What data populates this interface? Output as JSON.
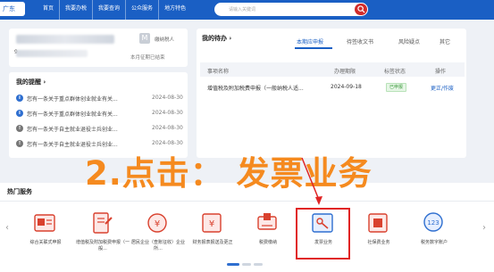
{
  "header": {
    "region": "广东",
    "nav": [
      "首页",
      "我要办税",
      "我要查询",
      "公众服务",
      "地方特色"
    ],
    "search_placeholder": "请输入关键词"
  },
  "user": {
    "id_prefix": "9",
    "role": "缴纳税人",
    "period": "本月征期已结束",
    "badge": "M"
  },
  "reminders": {
    "title": "我的提醒 ›",
    "items": [
      {
        "text": "您有一条关于重点群体创业就业有关...",
        "date": "2024-08-30",
        "color": "#2f6fd0",
        "icon": "i"
      },
      {
        "text": "您有一条关于重点群体创业就业有关...",
        "date": "2024-08-30",
        "color": "#2f6fd0",
        "icon": "i"
      },
      {
        "text": "您有一条关于自主就业退役士兵创业...",
        "date": "2024-08-30",
        "color": "#777777",
        "icon": "!"
      },
      {
        "text": "您有一条关于自主就业退役士兵创业...",
        "date": "2024-08-30",
        "color": "#777777",
        "icon": "!"
      }
    ]
  },
  "todo": {
    "title": "我的待办 ›",
    "tabs": [
      "本期应申报",
      "待签收文书",
      "风险疑点",
      "其它"
    ],
    "columns": [
      "事项名称",
      "办理期限",
      "标签状态",
      "操作"
    ],
    "rows": [
      {
        "name": "增值税及附加税费申报（一般纳税人适...",
        "deadline": "2024-09-18",
        "status": "已申报",
        "action": "更正/作废"
      }
    ]
  },
  "hot": {
    "title": "热门服务",
    "services": [
      {
        "label": "综合关联式申报",
        "icon": "declare-icon"
      },
      {
        "label": "增值税及附加税费申报（一般...",
        "icon": "vat-icon"
      },
      {
        "label": "居民企业（查账征收）企业所...",
        "icon": "enterprise-tax-icon"
      },
      {
        "label": "财务报表报送及更正",
        "icon": "report-icon"
      },
      {
        "label": "税费缴纳",
        "icon": "payment-icon"
      },
      {
        "label": "发票业务",
        "icon": "invoice-icon"
      },
      {
        "label": "社保费业务",
        "icon": "social-security-icon"
      },
      {
        "label": "税务数字账户",
        "icon": "digital-account-icon"
      }
    ]
  },
  "overlay": {
    "text": "2.点击：  发票业务"
  },
  "colors": {
    "brand": "#1a5fc4",
    "overlay": "#f58a1f",
    "highlight": "#e02424"
  }
}
